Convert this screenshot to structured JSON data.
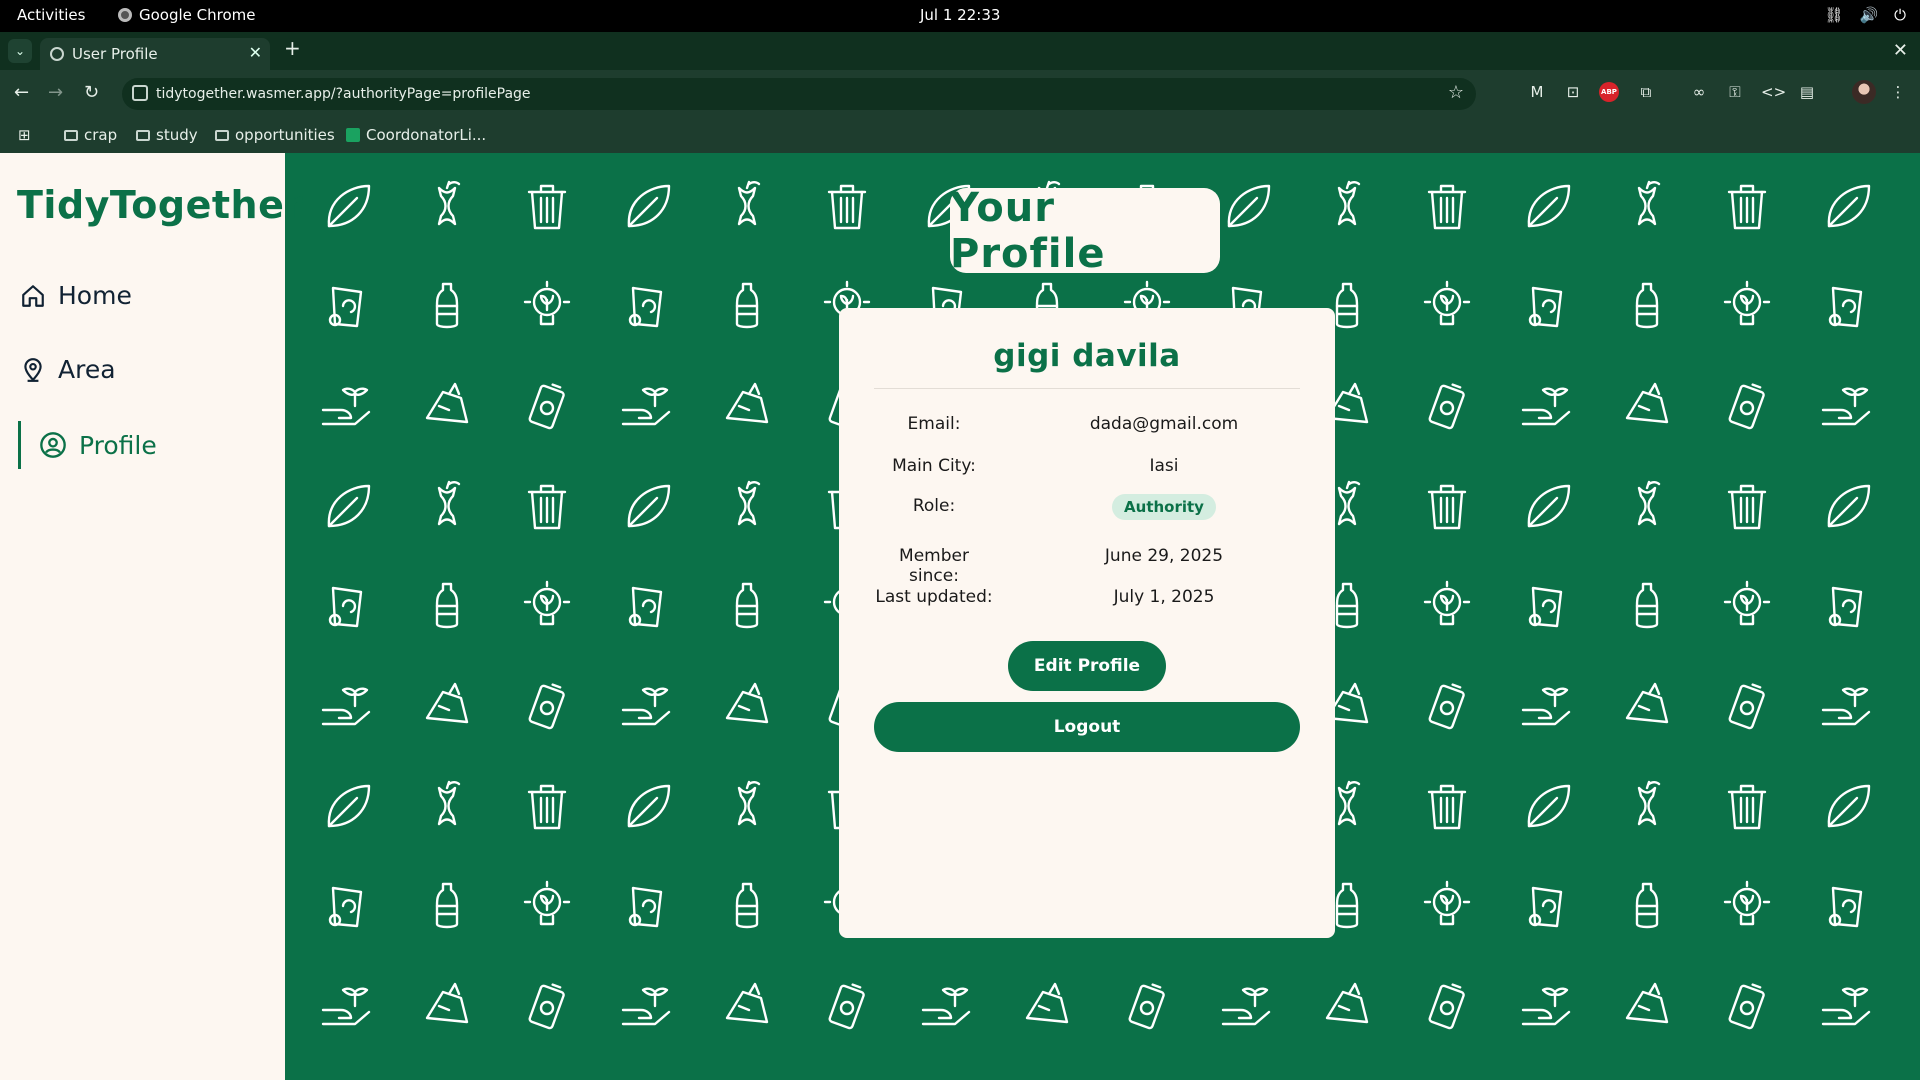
{
  "system": {
    "activities": "Activities",
    "app_name": "Google Chrome",
    "clock": "Jul 1  22:33"
  },
  "browser": {
    "tab_title": "User Profile",
    "url": "tidytogether.wasmer.app/?authorityPage=profilePage",
    "bookmarks": [
      "crap",
      "study",
      "opportunities",
      "CoordonatorLi..."
    ]
  },
  "sidebar": {
    "brand": "TidyTogether",
    "items": [
      {
        "label": "Home",
        "icon": "home-icon"
      },
      {
        "label": "Area",
        "icon": "location-pin-icon"
      },
      {
        "label": "Profile",
        "icon": "user-circle-icon"
      }
    ],
    "active": "Profile"
  },
  "page": {
    "title": "Your Profile"
  },
  "profile": {
    "name": "gigi davila",
    "fields": [
      {
        "label": "Email:",
        "value": "dada@gmail.com"
      },
      {
        "label": "Main City:",
        "value": "Iasi"
      },
      {
        "label": "Role:",
        "value": "Authority"
      },
      {
        "label": "Member since:",
        "value": "June 29, 2025"
      },
      {
        "label": "Last updated:",
        "value": "July 1, 2025"
      }
    ],
    "edit_label": "Edit Profile",
    "logout_label": "Logout"
  },
  "colors": {
    "brand_green": "#0b7148",
    "surface": "#fdf7f1",
    "badge_bg": "#d4ede0"
  }
}
